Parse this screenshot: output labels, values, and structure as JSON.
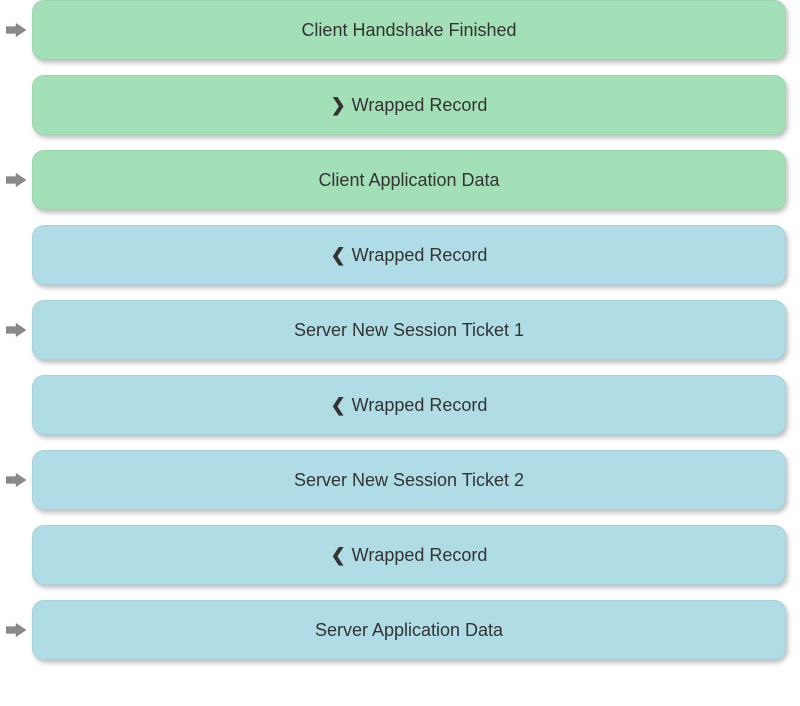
{
  "colors": {
    "green": "#a4e0b7",
    "blue": "#b0dce6"
  },
  "rows": [
    {
      "arrow": true,
      "color": "green",
      "chevron": "",
      "label": "Client Handshake Finished"
    },
    {
      "arrow": false,
      "color": "green",
      "chevron": "❯",
      "label": "Wrapped Record"
    },
    {
      "arrow": true,
      "color": "green",
      "chevron": "",
      "label": "Client Application Data"
    },
    {
      "arrow": false,
      "color": "blue",
      "chevron": "❮",
      "label": "Wrapped Record"
    },
    {
      "arrow": true,
      "color": "blue",
      "chevron": "",
      "label": "Server New Session Ticket 1"
    },
    {
      "arrow": false,
      "color": "blue",
      "chevron": "❮",
      "label": "Wrapped Record"
    },
    {
      "arrow": true,
      "color": "blue",
      "chevron": "",
      "label": "Server New Session Ticket 2"
    },
    {
      "arrow": false,
      "color": "blue",
      "chevron": "❮",
      "label": "Wrapped Record"
    },
    {
      "arrow": true,
      "color": "blue",
      "chevron": "",
      "label": "Server Application Data"
    }
  ]
}
